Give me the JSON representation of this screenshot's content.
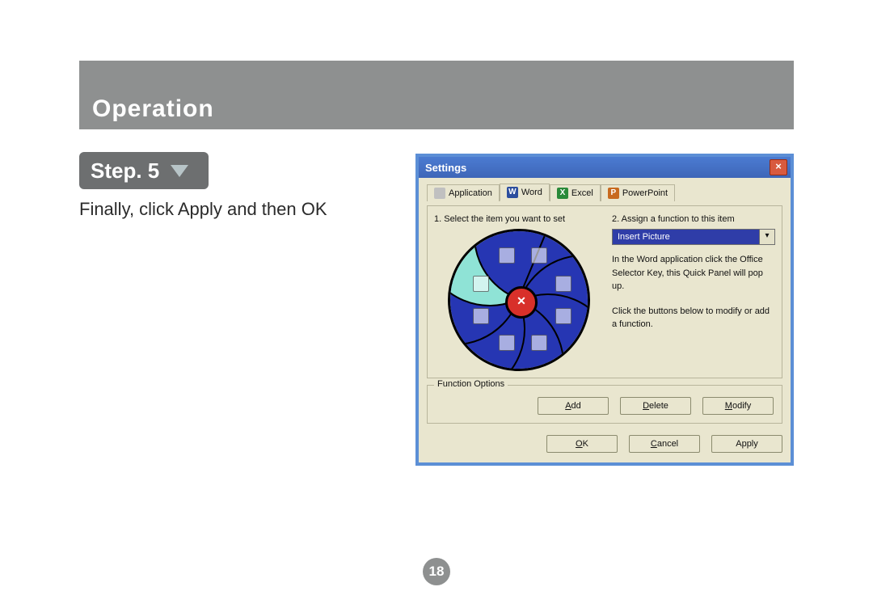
{
  "header": {
    "title": "Operation"
  },
  "step": {
    "label": "Step. 5"
  },
  "instruction": "Finally, click Apply and then OK",
  "page_number": "18",
  "dialog": {
    "title": "Settings",
    "close_icon": "×",
    "tabs": {
      "application": "Application",
      "word": "Word",
      "excel": "Excel",
      "powerpoint": "PowerPoint",
      "active": "Word"
    },
    "labels": {
      "select_item": "1. Select the item you want to set",
      "assign_fn": "2. Assign a function to this item",
      "function_options": "Function Options"
    },
    "dropdown": {
      "value": "Insert Picture",
      "arrow": "▾"
    },
    "help1": "In the Word application click the Office Selector Key, this Quick Panel will pop up.",
    "help2": "Click the buttons below to modify or add a function.",
    "buttons": {
      "add": "Add",
      "delete": "Delete",
      "modify": "Modify",
      "ok": "OK",
      "cancel": "Cancel",
      "apply": "Apply"
    },
    "wheel": {
      "segments": 8,
      "selected_index": 6,
      "center_symbol": "✕"
    }
  }
}
